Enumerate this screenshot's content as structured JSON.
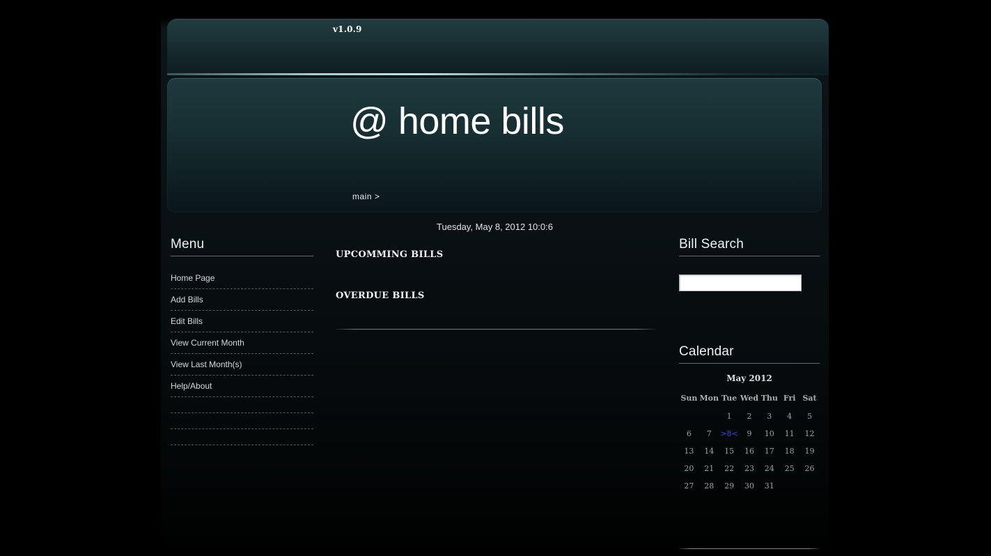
{
  "header": {
    "version": "v1.0.9",
    "site_title": "@ home bills",
    "breadcrumb": "main >"
  },
  "datetime": "Tuesday, May 8, 2012 10:0:6",
  "menu": {
    "heading": "Menu",
    "items": [
      {
        "label": "Home Page"
      },
      {
        "label": "Add Bills"
      },
      {
        "label": "Edit Bills"
      },
      {
        "label": "View Current Month"
      },
      {
        "label": "View Last Month(s)"
      },
      {
        "label": "Help/About"
      },
      {
        "label": ""
      },
      {
        "label": ""
      },
      {
        "label": ""
      }
    ]
  },
  "content": {
    "upcoming_heading": "UPCOMMING BILLS",
    "overdue_heading": "OVERDUE BILLS"
  },
  "search": {
    "heading": "Bill Search",
    "value": "",
    "placeholder": ""
  },
  "calendar": {
    "heading": "Calendar",
    "caption": "May 2012",
    "weekdays": [
      "Sun",
      "Mon",
      "Tue",
      "Wed",
      "Thu",
      "Fri",
      "Sat"
    ],
    "today": "8",
    "today_label": ">8<",
    "weeks": [
      [
        "",
        "",
        "1",
        "2",
        "3",
        "4",
        "5"
      ],
      [
        "6",
        "7",
        ">8<",
        "9",
        "10",
        "11",
        "12"
      ],
      [
        "13",
        "14",
        "15",
        "16",
        "17",
        "18",
        "19"
      ],
      [
        "20",
        "21",
        "22",
        "23",
        "24",
        "25",
        "26"
      ],
      [
        "27",
        "28",
        "29",
        "30",
        "31",
        "",
        ""
      ]
    ]
  },
  "colors": {
    "accent_teal": "#1e3a3e",
    "today_blue": "#3b49d8",
    "text_primary": "#eef3f4",
    "background": "#000000"
  }
}
